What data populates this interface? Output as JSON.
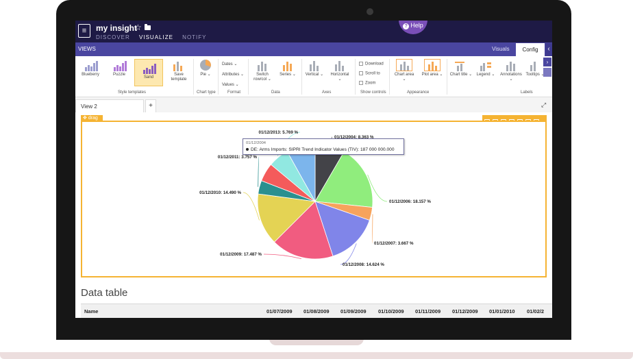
{
  "app": {
    "title": "my insight",
    "nav": [
      "DISCOVER",
      "VISUALIZE",
      "NOTIFY"
    ],
    "help_label": "Help"
  },
  "views_bar": {
    "title": "VIEWS",
    "tab_visuals": "Visuals",
    "tab_config": "Config"
  },
  "ribbon": {
    "style_templates": [
      "Blueberry",
      "Puzzle",
      "Sand"
    ],
    "save_template": "Save template",
    "chart_type": "Pie",
    "format_items": [
      "Dates",
      "Attributes",
      "Values"
    ],
    "switch_label": "Switch row/col",
    "series_label": "Series",
    "axes_items": [
      "Vertical",
      "Horizontal"
    ],
    "show_controls": [
      "Download",
      "Scroll to",
      "Zoom"
    ],
    "appearance_items": [
      "Chart area",
      "Plot area"
    ],
    "labels_items": [
      "Chart title",
      "Legend",
      "Annotations",
      "Tooltips"
    ],
    "groups": [
      "Style templates",
      "Chart type",
      "Format",
      "Data",
      "Axes",
      "Show controls",
      "Appearance",
      "Labels"
    ]
  },
  "tabs": {
    "view_name": "View 2",
    "add_label": "+"
  },
  "panel": {
    "drag_label": "drag"
  },
  "tooltip": {
    "date": "01/12/2004",
    "text": "DE: Arms Imports: SIPRI Trend Indicator Values (TIV): 187 000 000.000"
  },
  "chart_data": {
    "type": "pie",
    "slices": [
      {
        "label": "01/12/2004: 8.363 %",
        "value": 8.363,
        "color": "#434348"
      },
      {
        "label": "01/12/2006: 18.157 %",
        "value": 18.157,
        "color": "#90ed7d"
      },
      {
        "label": "01/12/2007: 3.667 %",
        "value": 3.667,
        "color": "#f7a35c"
      },
      {
        "label": "01/12/2008: 14.624 %",
        "value": 14.624,
        "color": "#8085e9"
      },
      {
        "label": "01/12/2009: 17.487 %",
        "value": 17.487,
        "color": "#f15c80"
      },
      {
        "label": "01/12/2010: 14.490 %",
        "value": 14.49,
        "color": "#e4d354"
      },
      {
        "label": "01/12/2011: 3.757 %",
        "value": 3.757,
        "color": "#2b908f"
      },
      {
        "label": "",
        "value": 5.2,
        "color": "#f45b5b"
      },
      {
        "label": "01/12/2013: 5.769 %",
        "value": 5.769,
        "color": "#91e8e1"
      },
      {
        "label": "",
        "value": 8.1,
        "color": "#7cb5ec"
      }
    ]
  },
  "data_table": {
    "title": "Data table",
    "columns": [
      "Name",
      "01/07/2009",
      "01/08/2009",
      "01/09/2009",
      "01/10/2009",
      "01/11/2009",
      "01/12/2009",
      "01/01/2010",
      "01/02/2"
    ]
  }
}
